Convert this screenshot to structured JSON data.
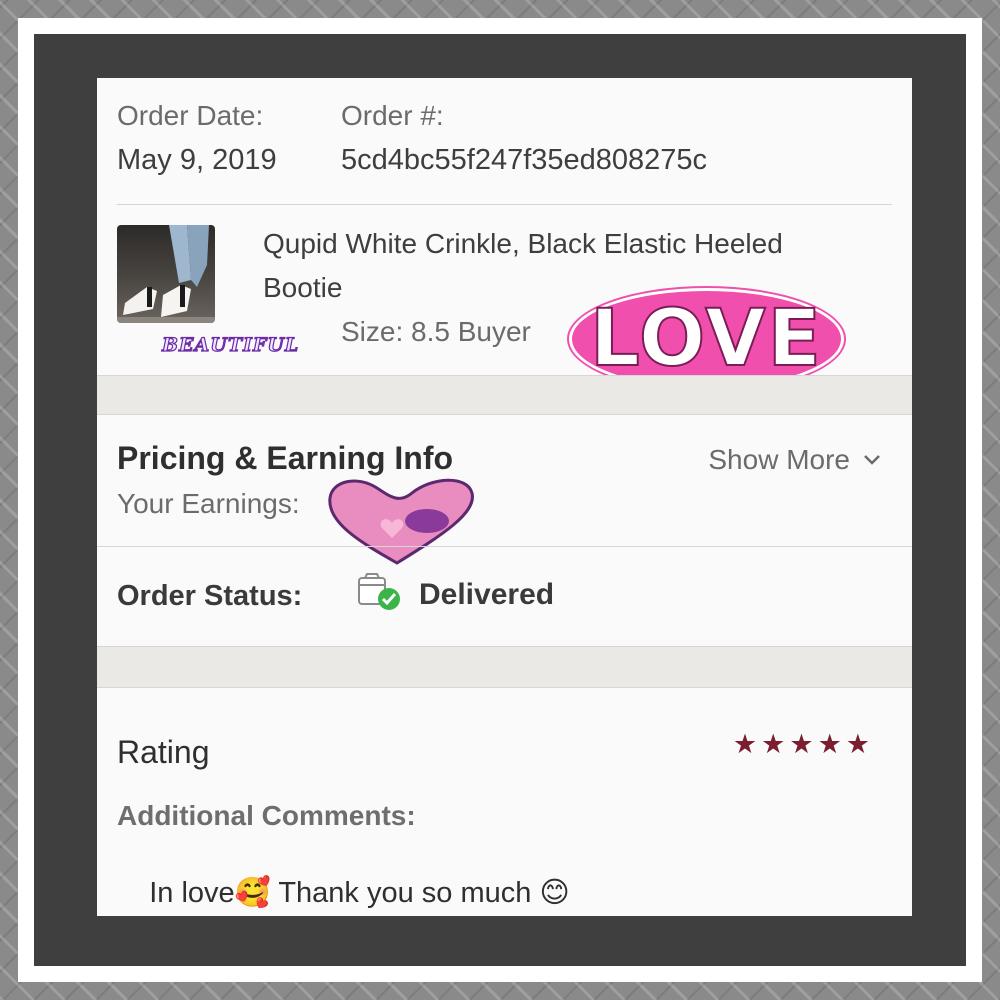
{
  "order": {
    "date_label": "Order Date:",
    "date_value": "May 9, 2019",
    "number_label": "Order #:",
    "number_value": "5cd4bc55f247f35ed808275c"
  },
  "item": {
    "title_line1": "Qupid White Crinkle, Black Elastic Heeled",
    "title_line2": "Bootie",
    "details": "Size: 8.5  Buyer",
    "thumbnail_icon": "boots-photo-thumbnail"
  },
  "pricing": {
    "heading": "Pricing & Earning Info",
    "show_more": "Show More",
    "earnings_label": "Your Earnings:"
  },
  "status": {
    "label": "Order Status:",
    "value": "Delivered",
    "icon": "package-delivered-icon",
    "check_color": "#3bb54a"
  },
  "rating": {
    "heading": "Rating",
    "stars": 5,
    "max_stars": 5,
    "star_color": "#7b1f30"
  },
  "comments": {
    "label": "Additional Comments:",
    "text_before": "In love",
    "emoji1": "🥰",
    "text_after": " Thank you so much ",
    "emoji2": "😊"
  },
  "stickers": {
    "love": "LOVE",
    "beautiful": "BEAUTIFUL",
    "love_color": "#f04fae"
  }
}
